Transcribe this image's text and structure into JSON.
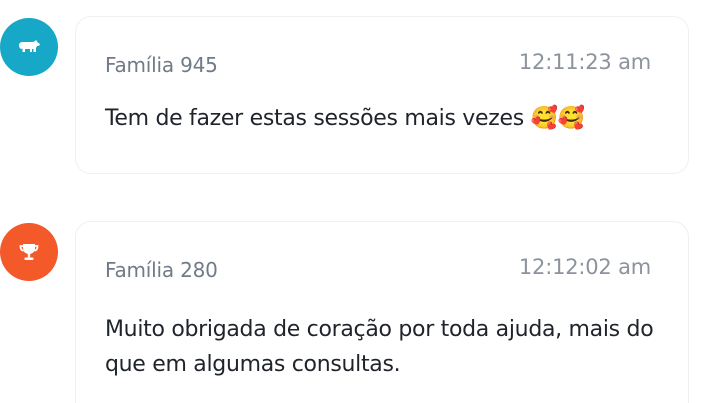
{
  "messages": [
    {
      "avatar": {
        "icon": "bear-icon",
        "color": "#16a8c6"
      },
      "sender": "Família 945",
      "time": "12:11:23 am",
      "text": "Tem de fazer estas sessões mais vezes 🥰🥰"
    },
    {
      "avatar": {
        "icon": "trophy-icon",
        "color": "#f4592a"
      },
      "sender": "Família 280",
      "time": "12:12:02 am",
      "text": "Muito obrigada de coração por toda ajuda, mais do que em algumas consultas."
    }
  ]
}
